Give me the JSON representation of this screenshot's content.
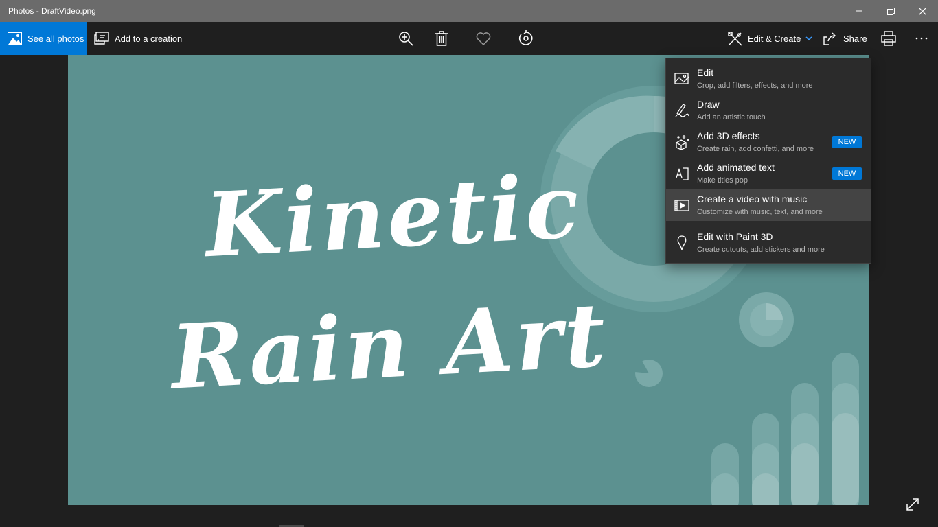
{
  "window": {
    "title": "Photos - DraftVideo.png"
  },
  "toolbar": {
    "see_all_photos": "See all photos",
    "add_to_creation": "Add to a creation",
    "edit_create": "Edit & Create",
    "share": "Share"
  },
  "image": {
    "line1": "Kinetic",
    "line2": "Rain Art",
    "background_color": "#5c9190"
  },
  "menu": {
    "items": [
      {
        "title": "Edit",
        "subtitle": "Crop, add filters, effects, and more",
        "icon": "edit-image-icon"
      },
      {
        "title": "Draw",
        "subtitle": "Add an artistic touch",
        "icon": "draw-pen-icon"
      },
      {
        "title": "Add 3D effects",
        "subtitle": "Create rain, add confetti, and more",
        "icon": "3d-effects-icon",
        "badge": "NEW"
      },
      {
        "title": "Add animated text",
        "subtitle": "Make titles pop",
        "icon": "animated-text-icon",
        "badge": "NEW"
      },
      {
        "title": "Create a video with music",
        "subtitle": "Customize with music, text, and more",
        "icon": "video-music-icon"
      },
      {
        "title": "Edit with Paint 3D",
        "subtitle": "Create cutouts, add stickers and more",
        "icon": "paint-3d-icon"
      }
    ]
  },
  "colors": {
    "accent": "#0078d7",
    "menu_bg": "#2b2b2b",
    "menu_hover": "#444444",
    "app_bg": "#1f1f1f",
    "titlebar": "#6b6b6b"
  }
}
